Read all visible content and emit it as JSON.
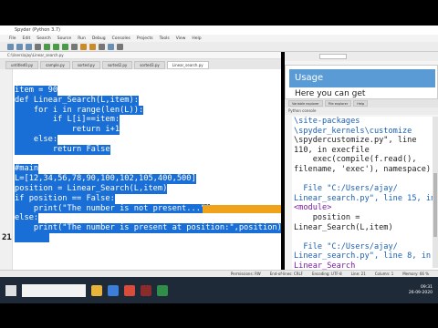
{
  "window": {
    "title": "Spyder (Python 3.7)",
    "menu": [
      "File",
      "Edit",
      "Search",
      "Source",
      "Run",
      "Debug",
      "Consoles",
      "Projects",
      "Tools",
      "View",
      "Help"
    ],
    "path": "C:\\Users\\ajay\\Linear_search.py",
    "working_dir": "C:\\Users\\ajay"
  },
  "editor": {
    "tabs": [
      "untitled0.py",
      "sample.py",
      "sorted.py",
      "sorted2.py",
      "sorted3.py",
      "Linear_search.py"
    ],
    "active_tab": "Linear_search.py",
    "lines": [
      "item = 90",
      "def Linear_Search(L,item):",
      "    for i in range(len(L)):",
      "        if L[i]==item:",
      "            return i+1",
      "    else:",
      "        return False",
      "",
      "#main",
      "L=[12,34,56,78,90,100,102,105,400,500]",
      "position = Linear_Search(L,item)",
      "if position == False:",
      "    print(\"The number is not present...\")",
      "else:",
      "    print(\"The number is present at position:\",position)",
      ""
    ],
    "current_line_number": "21"
  },
  "help": {
    "heading": "Usage",
    "text": "Here you can get"
  },
  "panes": {
    "tabs": [
      "Variable explorer",
      "File explorer",
      "Help"
    ],
    "console_label": "Python console"
  },
  "console": {
    "lines": [
      {
        "text": "\\site-packages",
        "cls": "blue"
      },
      {
        "text": "\\spyder_kernels\\customize",
        "cls": "blue"
      },
      {
        "text": "\\spydercustomize.py\", line",
        "cls": ""
      },
      {
        "text": "110, in execfile",
        "cls": ""
      },
      {
        "text": "    exec(compile(f.read(),",
        "cls": ""
      },
      {
        "text": "filename, 'exec'), namespace)",
        "cls": ""
      },
      {
        "text": "",
        "cls": ""
      },
      {
        "text": "  File \"C:/Users/ajay/",
        "cls": "blue"
      },
      {
        "text": "Linear_search.py\", line 15, in",
        "cls": "blue"
      },
      {
        "text": "<module>",
        "cls": "purple"
      },
      {
        "text": "    position =",
        "cls": ""
      },
      {
        "text": "Linear_Search(L,item)",
        "cls": ""
      },
      {
        "text": "",
        "cls": ""
      },
      {
        "text": "  File \"C:/Users/ajay/",
        "cls": "blue"
      },
      {
        "text": "Linear_search.py\", line 8, in",
        "cls": "blue"
      },
      {
        "text": "Linear_Search",
        "cls": "purple"
      }
    ]
  },
  "status": {
    "items": [
      "Permissions: RW",
      "End-of-lines: CRLF",
      "Encoding: UTF-8",
      "Line: 21",
      "Column: 1",
      "Memory: 66 %"
    ]
  },
  "taskbar": {
    "time": "09:31",
    "date": "26-09-2020"
  },
  "colors": {
    "selection": "#1a6fd6",
    "highlight": "#f0a21a",
    "help_header": "#5a9bd5"
  }
}
